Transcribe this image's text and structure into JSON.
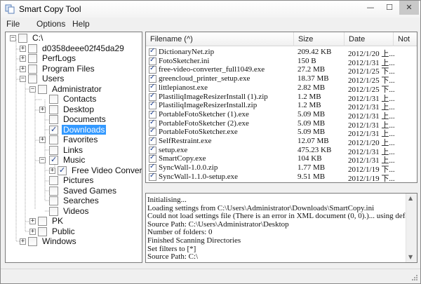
{
  "window": {
    "title": "Smart Copy Tool",
    "icon": "copy-app-icon"
  },
  "window_controls": {
    "minimize": "—",
    "maximize": "☐",
    "close": "✕"
  },
  "menu": {
    "file": "File",
    "options": "Options",
    "help": "Help"
  },
  "tree": {
    "root": "C:\\",
    "d0358": "d0358deee02f45da29",
    "perflogs": "PerfLogs",
    "program_files": "Program Files",
    "users": "Users",
    "administrator": "Administrator",
    "contacts": "Contacts",
    "desktop": "Desktop",
    "documents": "Documents",
    "downloads": "Downloads",
    "favorites": "Favorites",
    "links": "Links",
    "music": "Music",
    "free_video": "Free Video Converte",
    "pictures": "Pictures",
    "saved_games": "Saved Games",
    "searches": "Searches",
    "videos": "Videos",
    "pk": "PK",
    "public": "Public",
    "windows": "Windows"
  },
  "file_list": {
    "columns": {
      "name": "Filename (^)",
      "size": "Size",
      "date": "Date",
      "note": "Not"
    },
    "rows": [
      {
        "name": "DictionaryNet.zip",
        "size": "209.42 KB",
        "date": "2012/1/20 上..."
      },
      {
        "name": "FotoSketcher.ini",
        "size": "150 B",
        "date": "2012/1/31 上..."
      },
      {
        "name": "free-video-converter_full1049.exe",
        "size": "27.2 MB",
        "date": "2012/1/25 下..."
      },
      {
        "name": "greencloud_printer_setup.exe",
        "size": "18.37 MB",
        "date": "2012/1/25 下..."
      },
      {
        "name": "littlepianost.exe",
        "size": "2.82 MB",
        "date": "2012/1/25 下..."
      },
      {
        "name": "PlastiliqImageResizerInstall (1).zip",
        "size": "1.2 MB",
        "date": "2012/1/31 上..."
      },
      {
        "name": "PlastiliqImageResizerInstall.zip",
        "size": "1.2 MB",
        "date": "2012/1/31 上..."
      },
      {
        "name": "PortableFotoSketcher (1).exe",
        "size": "5.09 MB",
        "date": "2012/1/31 上..."
      },
      {
        "name": "PortableFotoSketcher (2).exe",
        "size": "5.09 MB",
        "date": "2012/1/31 上..."
      },
      {
        "name": "PortableFotoSketcher.exe",
        "size": "5.09 MB",
        "date": "2012/1/31 上..."
      },
      {
        "name": "SelfRestraint.exe",
        "size": "12.07 MB",
        "date": "2012/1/20 上..."
      },
      {
        "name": "setup.exe",
        "size": "475.23 KB",
        "date": "2012/1/31 上..."
      },
      {
        "name": "SmartCopy.exe",
        "size": "104 KB",
        "date": "2012/1/31 上..."
      },
      {
        "name": "SyncWall-1.0.0.zip",
        "size": "1.77 MB",
        "date": "2012/1/19 下..."
      },
      {
        "name": "SyncWall-1.1.0-setup.exe",
        "size": "9.51 MB",
        "date": "2012/1/19 下..."
      }
    ]
  },
  "log": {
    "lines": [
      "Initialising...",
      "Loading settings from C:\\Users\\Administrator\\Downloads\\SmartCopy.ini",
      "Could not load settings file (There is an error in XML document (0, 0).)... using default settings",
      "Source Path: C:\\Users\\Administrator\\Desktop",
      "Number of folders: 0",
      "Finished Scanning Directories",
      "Set filters to [*]",
      "Source Path: C:\\"
    ]
  },
  "scroll": {
    "up": "▲",
    "down": "▼"
  },
  "colors": {
    "selection": "#3399ff",
    "check": "#1c3f91",
    "border": "#7a7a7a"
  }
}
